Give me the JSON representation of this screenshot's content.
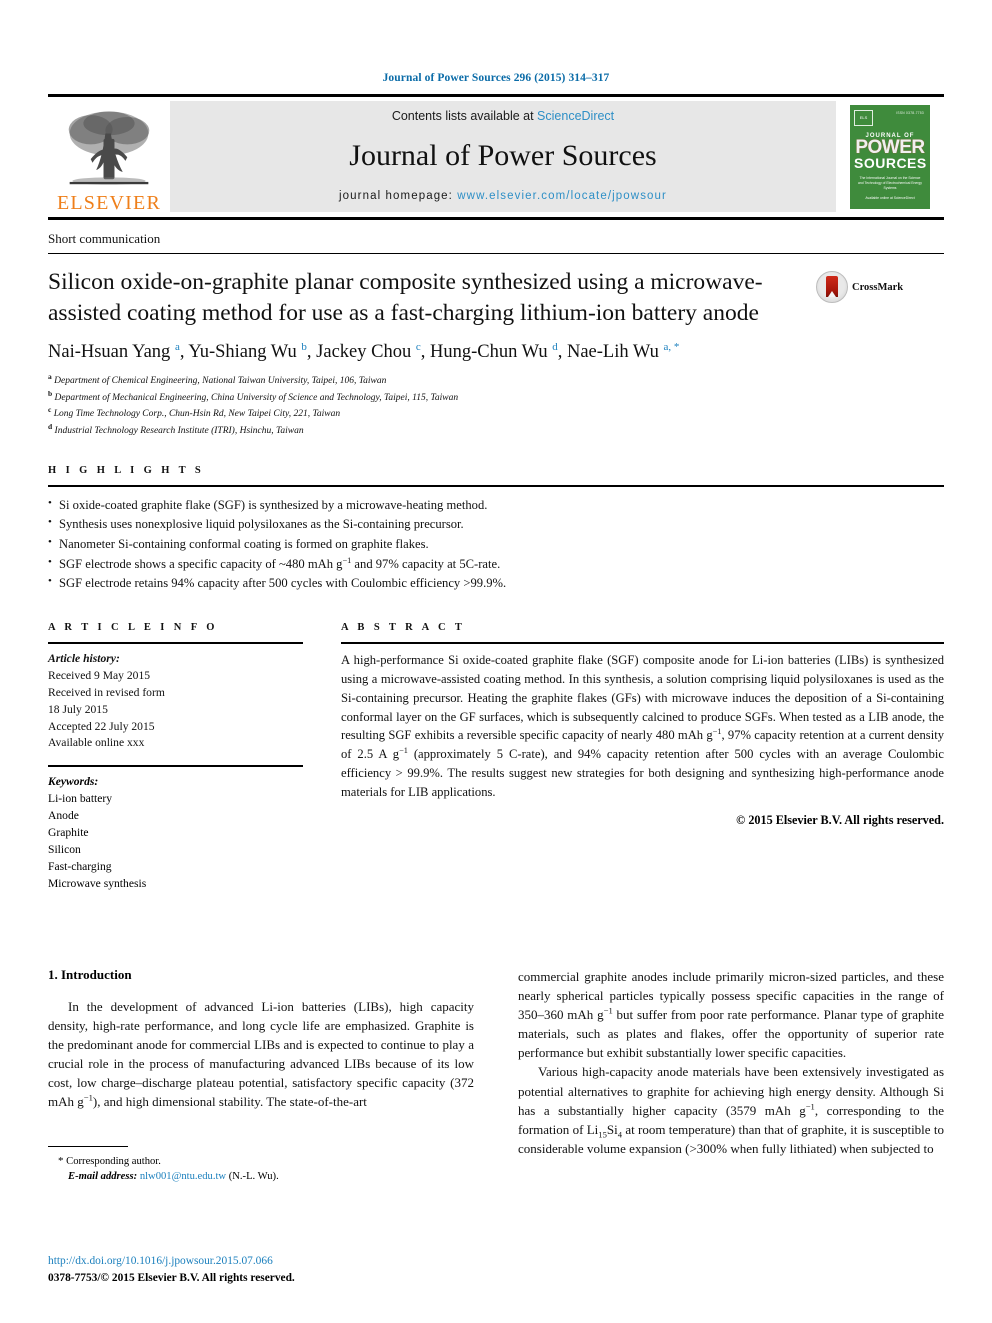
{
  "running_head": "Journal of Power Sources 296 (2015) 314–317",
  "masthead": {
    "publisher_name": "ELSEVIER",
    "contents_prefix": "Contents lists available at ",
    "contents_link": "ScienceDirect",
    "journal_name": "Journal of Power Sources",
    "homepage_prefix": "journal homepage: ",
    "homepage_url": "www.elsevier.com/locate/jpowsour",
    "cover": {
      "top_note": "ISSN 0378-7753",
      "line1": "JOURNAL OF",
      "line2": "POWER",
      "line3": "SOURCES",
      "subtitle": "The International Journal on the Science and Technology of Electrochemical Energy Systems",
      "footer": "Available online at\nScienceDirect"
    }
  },
  "article": {
    "type": "Short communication",
    "title": "Silicon oxide-on-graphite planar composite synthesized using a microwave-assisted coating method for use as a fast-charging lithium-ion battery anode",
    "crossmark_label": "CrossMark",
    "authors": [
      {
        "name": "Nai-Hsuan Yang",
        "marks": "a"
      },
      {
        "name": "Yu-Shiang Wu",
        "marks": "b"
      },
      {
        "name": "Jackey Chou",
        "marks": "c"
      },
      {
        "name": "Hung-Chun Wu",
        "marks": "d"
      },
      {
        "name": "Nae-Lih Wu",
        "marks": "a, *"
      }
    ],
    "affiliations": [
      {
        "mark": "a",
        "text": "Department of Chemical Engineering, National Taiwan University, Taipei, 106, Taiwan"
      },
      {
        "mark": "b",
        "text": "Department of Mechanical Engineering, China University of Science and Technology, Taipei, 115, Taiwan"
      },
      {
        "mark": "c",
        "text": "Long Time Technology Corp., Chun-Hsin Rd, New Taipei City, 221, Taiwan"
      },
      {
        "mark": "d",
        "text": "Industrial Technology Research Institute (ITRI), Hsinchu, Taiwan"
      }
    ]
  },
  "highlights": {
    "heading": "H I G H L I G H T S",
    "items": [
      "Si oxide-coated graphite flake (SGF) is synthesized by a microwave-heating method.",
      "Synthesis uses nonexplosive liquid polysiloxanes as the Si-containing precursor.",
      "Nanometer Si-containing conformal coating is formed on graphite flakes.",
      "SGF electrode shows a specific capacity of ~480 mAh g−1 and 97% capacity at 5C-rate.",
      "SGF electrode retains 94% capacity after 500 cycles with Coulombic efficiency >99.9%."
    ]
  },
  "article_info": {
    "heading": "A R T I C L E  I N F O",
    "history_label": "Article history:",
    "history": [
      "Received 9 May 2015",
      "Received in revised form",
      "18 July 2015",
      "Accepted 22 July 2015",
      "Available online xxx"
    ],
    "keywords_label": "Keywords:",
    "keywords": [
      "Li-ion battery",
      "Anode",
      "Graphite",
      "Silicon",
      "Fast-charging",
      "Microwave synthesis"
    ]
  },
  "abstract": {
    "heading": "A B S T R A C T",
    "text": "A high-performance Si oxide-coated graphite flake (SGF) composite anode for Li-ion batteries (LIBs) is synthesized using a microwave-assisted coating method. In this synthesis, a solution comprising liquid polysiloxanes is used as the Si-containing precursor. Heating the graphite flakes (GFs) with microwave induces the deposition of a Si-containing conformal layer on the GF surfaces, which is subsequently calcined to produce SGFs. When tested as a LIB anode, the resulting SGF exhibits a reversible specific capacity of nearly 480 mAh g−1, 97% capacity retention at a current density of 2.5 A g−1 (approximately 5 C-rate), and 94% capacity retention after 500 cycles with an average Coulombic efficiency > 99.9%. The results suggest new strategies for both designing and synthesizing high-performance anode materials for LIB applications.",
    "copyright": "© 2015 Elsevier B.V. All rights reserved."
  },
  "body": {
    "section_number_title": "1.  Introduction",
    "left_paragraphs": [
      "In the development of advanced Li-ion batteries (LIBs), high capacity density, high-rate performance, and long cycle life are emphasized. Graphite is the predominant anode for commercial LIBs and is expected to continue to play a crucial role in the process of manufacturing advanced LIBs because of its low cost, low charge–discharge plateau potential, satisfactory specific capacity (372 mAh g−1), and high dimensional stability. The state-of-the-art"
    ],
    "right_paragraphs": [
      "commercial graphite anodes include primarily micron-sized particles, and these nearly spherical particles typically possess specific capacities in the range of 350–360 mAh g−1 but suffer from poor rate performance. Planar type of graphite materials, such as plates and flakes, offer the opportunity of superior rate performance but exhibit substantially lower specific capacities.",
      "Various high-capacity anode materials have been extensively investigated as potential alternatives to graphite for achieving high energy density. Although Si has a substantially higher capacity (3579 mAh g−1, corresponding to the formation of Li15Si4 at room temperature) than that of graphite, it is susceptible to considerable volume expansion (>300% when fully lithiated) when subjected to"
    ],
    "corresponding_author_label": "Corresponding author.",
    "email_label": "E-mail address:",
    "email": "nlw001@ntu.edu.tw",
    "email_attribution": "(N.-L. Wu)."
  },
  "footer": {
    "doi": "http://dx.doi.org/10.1016/j.jpowsour.2015.07.066",
    "issn_line": "0378-7753/© 2015 Elsevier B.V. All rights reserved."
  },
  "colors": {
    "link_blue": "#1a7fbd",
    "elsevier_orange": "#ef7f1a",
    "cover_green": "#3f8b3c",
    "band_gray": "#e7e7e7"
  }
}
